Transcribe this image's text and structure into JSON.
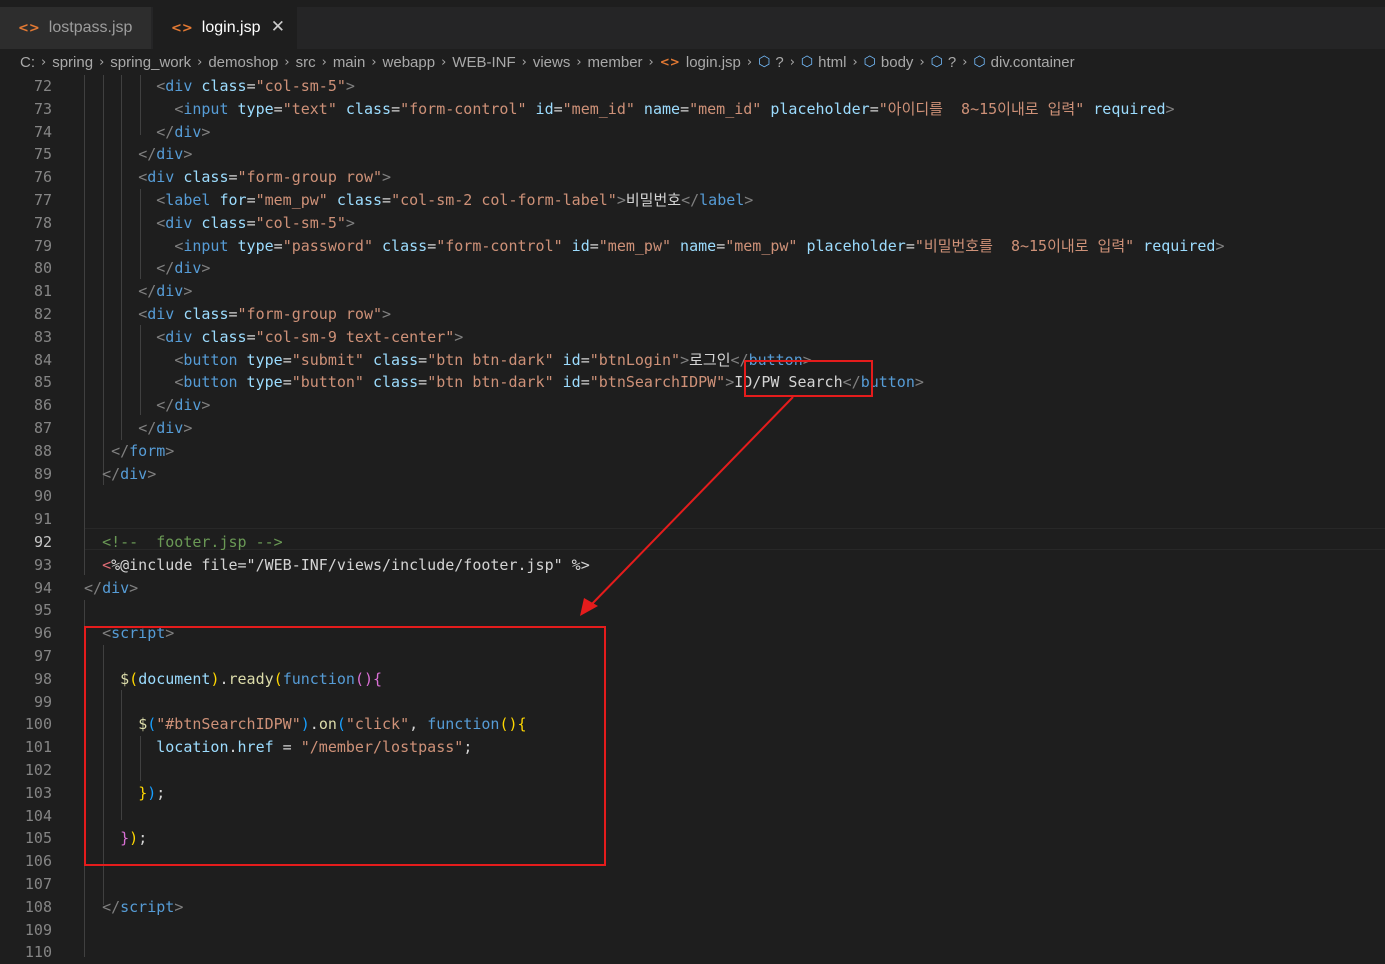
{
  "tabs": [
    {
      "label": "lostpass.jsp",
      "icon": "code-file-icon",
      "active": false
    },
    {
      "label": "login.jsp",
      "icon": "code-file-icon",
      "active": true,
      "close": "✕"
    }
  ],
  "breadcrumb": {
    "items": [
      "C:",
      "spring",
      "spring_work",
      "demoshop",
      "src",
      "main",
      "webapp",
      "WEB-INF",
      "views",
      "member"
    ],
    "file": "login.jsp",
    "symbols": [
      "?",
      "html",
      "body",
      "?",
      "div.container"
    ]
  },
  "line_numbers": [
    "72",
    "73",
    "74",
    "75",
    "76",
    "77",
    "78",
    "79",
    "80",
    "81",
    "82",
    "83",
    "84",
    "85",
    "86",
    "87",
    "88",
    "89",
    "90",
    "91",
    "92",
    "93",
    "94",
    "95",
    "96",
    "97",
    "98",
    "99",
    "100",
    "101",
    "102",
    "103",
    "104",
    "105",
    "106",
    "107",
    "108",
    "109",
    "110"
  ],
  "current_line": "92",
  "code": {
    "l72": {
      "indent": "        ",
      "open": "<",
      "tag": "div",
      "attr1": " class",
      "eq": "=",
      "val1": "\"col-sm-5\"",
      "close": ">"
    },
    "l73": {
      "indent": "          ",
      "open": "<",
      "tag": "input",
      "attr1": " type",
      "val1": "\"text\"",
      "attr2": " class",
      "val2": "\"form-control\"",
      "attr3": " id",
      "val3": "\"mem_id\"",
      "attr4": " name",
      "val4": "\"mem_id\"",
      "attr5": " placeholder",
      "val5": "\"아이디를  8~15이내로 입력\"",
      "attr6": " required",
      "close": ">"
    },
    "l74": {
      "indent": "        ",
      "open": "</",
      "tag": "div",
      "close": ">"
    },
    "l75": {
      "indent": "      ",
      "open": "</",
      "tag": "div",
      "close": ">"
    },
    "l76": {
      "indent": "      ",
      "open": "<",
      "tag": "div",
      "attr1": " class",
      "val1": "\"form-group row\"",
      "close": ">"
    },
    "l77": {
      "indent": "        ",
      "open": "<",
      "tag": "label",
      "attr1": " for",
      "val1": "\"mem_pw\"",
      "attr2": " class",
      "val2": "\"col-sm-2 col-form-label\"",
      "close": ">",
      "text": "비밀번호",
      "open2": "</",
      "tag2": "label",
      "close2": ">"
    },
    "l78": {
      "indent": "        ",
      "open": "<",
      "tag": "div",
      "attr1": " class",
      "val1": "\"col-sm-5\"",
      "close": ">"
    },
    "l79": {
      "indent": "          ",
      "open": "<",
      "tag": "input",
      "attr1": " type",
      "val1": "\"password\"",
      "attr2": " class",
      "val2": "\"form-control\"",
      "attr3": " id",
      "val3": "\"mem_pw\"",
      "attr4": " name",
      "val4": "\"mem_pw\"",
      "attr5": " placeholder",
      "val5": "\"비밀번호를  8~15이내로 입력\"",
      "attr6": " required",
      "close": ">"
    },
    "l80": {
      "indent": "        ",
      "open": "</",
      "tag": "div",
      "close": ">"
    },
    "l81": {
      "indent": "      ",
      "open": "</",
      "tag": "div",
      "close": ">"
    },
    "l82": {
      "indent": "      ",
      "open": "<",
      "tag": "div",
      "attr1": " class",
      "val1": "\"form-group row\"",
      "close": ">"
    },
    "l83": {
      "indent": "        ",
      "open": "<",
      "tag": "div",
      "attr1": " class",
      "val1": "\"col-sm-9 text-center\"",
      "close": ">"
    },
    "l84": {
      "indent": "          ",
      "open": "<",
      "tag": "button",
      "attr1": " type",
      "val1": "\"submit\"",
      "attr2": " class",
      "val2": "\"btn btn-dark\"",
      "attr3": " id",
      "val3": "\"btnLogin\"",
      "close": ">",
      "text": "로그인",
      "open2": "</",
      "tag2": "button",
      "close2": ">"
    },
    "l85": {
      "indent": "          ",
      "open": "<",
      "tag": "button",
      "attr1": " type",
      "val1": "\"button\"",
      "attr2": " class",
      "val2": "\"btn btn-dark\"",
      "attr3": " id",
      "val3": "\"btnSearchIDPW\"",
      "close": ">",
      "text": "ID/PW Search",
      "open2": "</",
      "tag2": "button",
      "close2": ">"
    },
    "l86": {
      "indent": "        ",
      "open": "</",
      "tag": "div",
      "close": ">"
    },
    "l87": {
      "indent": "      ",
      "open": "</",
      "tag": "div",
      "close": ">"
    },
    "l88": {
      "indent": "   ",
      "open": "</",
      "tag": "form",
      "close": ">"
    },
    "l89": {
      "indent": "  ",
      "open": "</",
      "tag": "div",
      "close": ">"
    },
    "l92": {
      "indent": "  ",
      "comment": "<!--  footer.jsp -->"
    },
    "l93": {
      "indent": "  ",
      "open": "<",
      "directive": "%@include file=\"/WEB-INF/views/include/footer.jsp\" %",
      "close": ">"
    },
    "l94": {
      "indent": "",
      "open": "</",
      "tag": "div",
      "close": ">"
    },
    "l96": {
      "indent": "  ",
      "open": "<",
      "tag": "script",
      "close": ">"
    },
    "l98": {
      "indent": "    ",
      "dollar": "$",
      "p1": "(",
      "obj": "document",
      "p2": ")",
      "dot": ".",
      "fn": "ready",
      "p3": "(",
      "kw": "function",
      "p4": "()",
      "b1": "{"
    },
    "l100": {
      "indent": "      ",
      "dollar": "$",
      "p1": "(",
      "str": "\"#btnSearchIDPW\"",
      "p2": ")",
      "dot": ".",
      "fn": "on",
      "p3": "(",
      "str2": "\"click\"",
      "comma": ", ",
      "kw": "function",
      "p4": "()",
      "b1": "{"
    },
    "l101": {
      "indent": "        ",
      "obj": "location",
      "dot": ".",
      "prop": "href",
      "eq": " = ",
      "str": "\"/member/lostpass\"",
      "semi": ";"
    },
    "l103": {
      "indent": "      ",
      "b1": "}",
      "p1": ")",
      "semi": ";"
    },
    "l105": {
      "indent": "    ",
      "b1": "}",
      "p1": ")",
      "semi": ";"
    },
    "l108": {
      "indent": "  ",
      "open": "</",
      "tag": "script",
      "close": ">"
    }
  },
  "annotation": {
    "color": "#e51c1c"
  }
}
